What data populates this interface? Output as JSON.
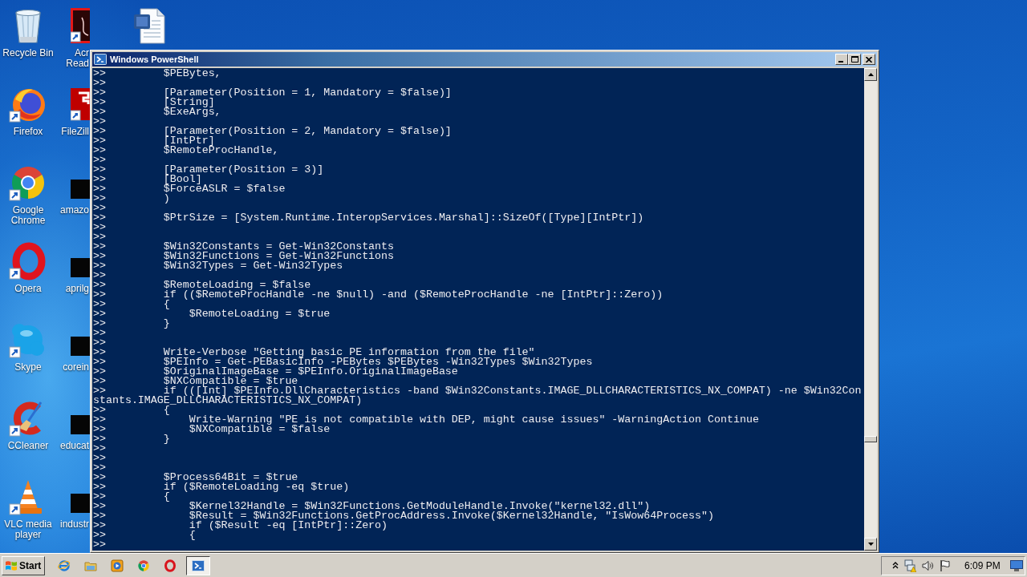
{
  "desktop": {
    "column_1": [
      "Recycle Bin",
      "Firefox",
      "Google Chrome",
      "Opera",
      "Skype",
      "CCleaner",
      "VLC media player"
    ],
    "column_2": [
      "Acr Read",
      "FileZill",
      "amazo",
      "aprilg",
      "corein",
      "educat",
      "industr"
    ]
  },
  "window": {
    "title": "Windows PowerShell",
    "console_lines": [
      ">>         $PEBytes,",
      ">>",
      ">>         [Parameter(Position = 1, Mandatory = $false)]",
      ">>         [String]",
      ">>         $ExeArgs,",
      ">>",
      ">>         [Parameter(Position = 2, Mandatory = $false)]",
      ">>         [IntPtr]",
      ">>         $RemoteProcHandle,",
      ">>",
      ">>         [Parameter(Position = 3)]",
      ">>         [Bool]",
      ">>         $ForceASLR = $false",
      ">>         )",
      ">>",
      ">>         $PtrSize = [System.Runtime.InteropServices.Marshal]::SizeOf([Type][IntPtr])",
      ">>",
      ">>",
      ">>         $Win32Constants = Get-Win32Constants",
      ">>         $Win32Functions = Get-Win32Functions",
      ">>         $Win32Types = Get-Win32Types",
      ">>",
      ">>         $RemoteLoading = $false",
      ">>         if (($RemoteProcHandle -ne $null) -and ($RemoteProcHandle -ne [IntPtr]::Zero))",
      ">>         {",
      ">>             $RemoteLoading = $true",
      ">>         }",
      ">>",
      ">>",
      ">>         Write-Verbose \"Getting basic PE information from the file\"",
      ">>         $PEInfo = Get-PEBasicInfo -PEBytes $PEBytes -Win32Types $Win32Types",
      ">>         $OriginalImageBase = $PEInfo.OriginalImageBase",
      ">>         $NXCompatible = $true",
      ">>         if (([Int] $PEInfo.DllCharacteristics -band $Win32Constants.IMAGE_DLLCHARACTERISTICS_NX_COMPAT) -ne $Win32Con",
      "stants.IMAGE_DLLCHARACTERISTICS_NX_COMPAT)",
      ">>         {",
      ">>             Write-Warning \"PE is not compatible with DEP, might cause issues\" -WarningAction Continue",
      ">>             $NXCompatible = $false",
      ">>         }",
      ">>",
      ">>",
      ">>",
      ">>         $Process64Bit = $true",
      ">>         if ($RemoteLoading -eq $true)",
      ">>         {",
      ">>             $Kernel32Handle = $Win32Functions.GetModuleHandle.Invoke(\"kernel32.dll\")",
      ">>             $Result = $Win32Functions.GetProcAddress.Invoke($Kernel32Handle, \"IsWow64Process\")",
      ">>             if ($Result -eq [IntPtr]::Zero)",
      ">>             {",
      ">>"
    ]
  },
  "taskbar": {
    "start_label": "Start",
    "windows": [
      {
        "selected": true
      }
    ],
    "clock": "6:09 PM"
  }
}
